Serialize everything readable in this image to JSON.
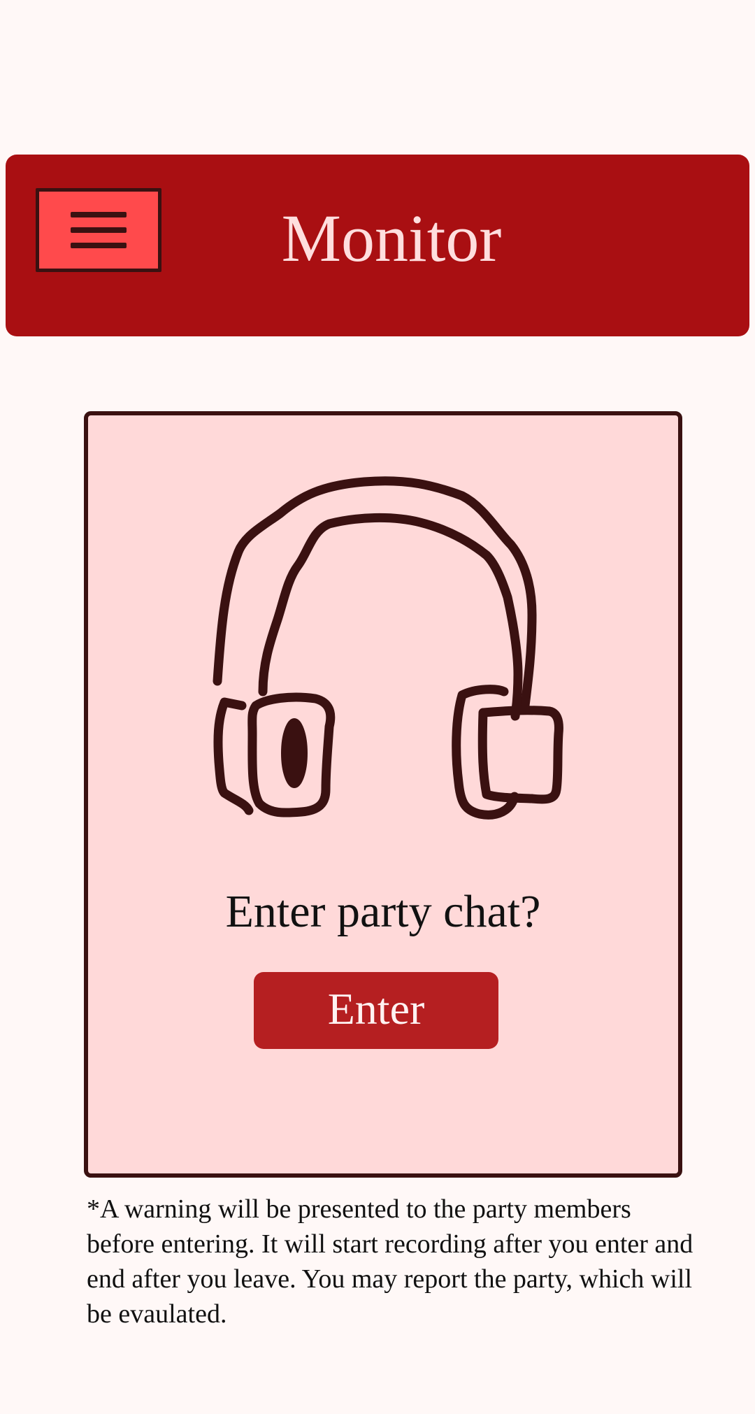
{
  "header": {
    "title": "Monitor",
    "menu_icon": "hamburger-menu-icon",
    "background_color": "#a90f12",
    "title_color": "#ffdede",
    "menu_button_color": "#ff4a4c"
  },
  "card": {
    "icon": "headphones-icon",
    "prompt": "Enter party chat?",
    "enter_label": "Enter",
    "background_color": "#ffd9d9",
    "button_color": "#b51f21"
  },
  "footnote": "*A warning will be presented to the party members before entering. It will start recording after you enter and end after you leave. You may report the party, which will be evaulated."
}
